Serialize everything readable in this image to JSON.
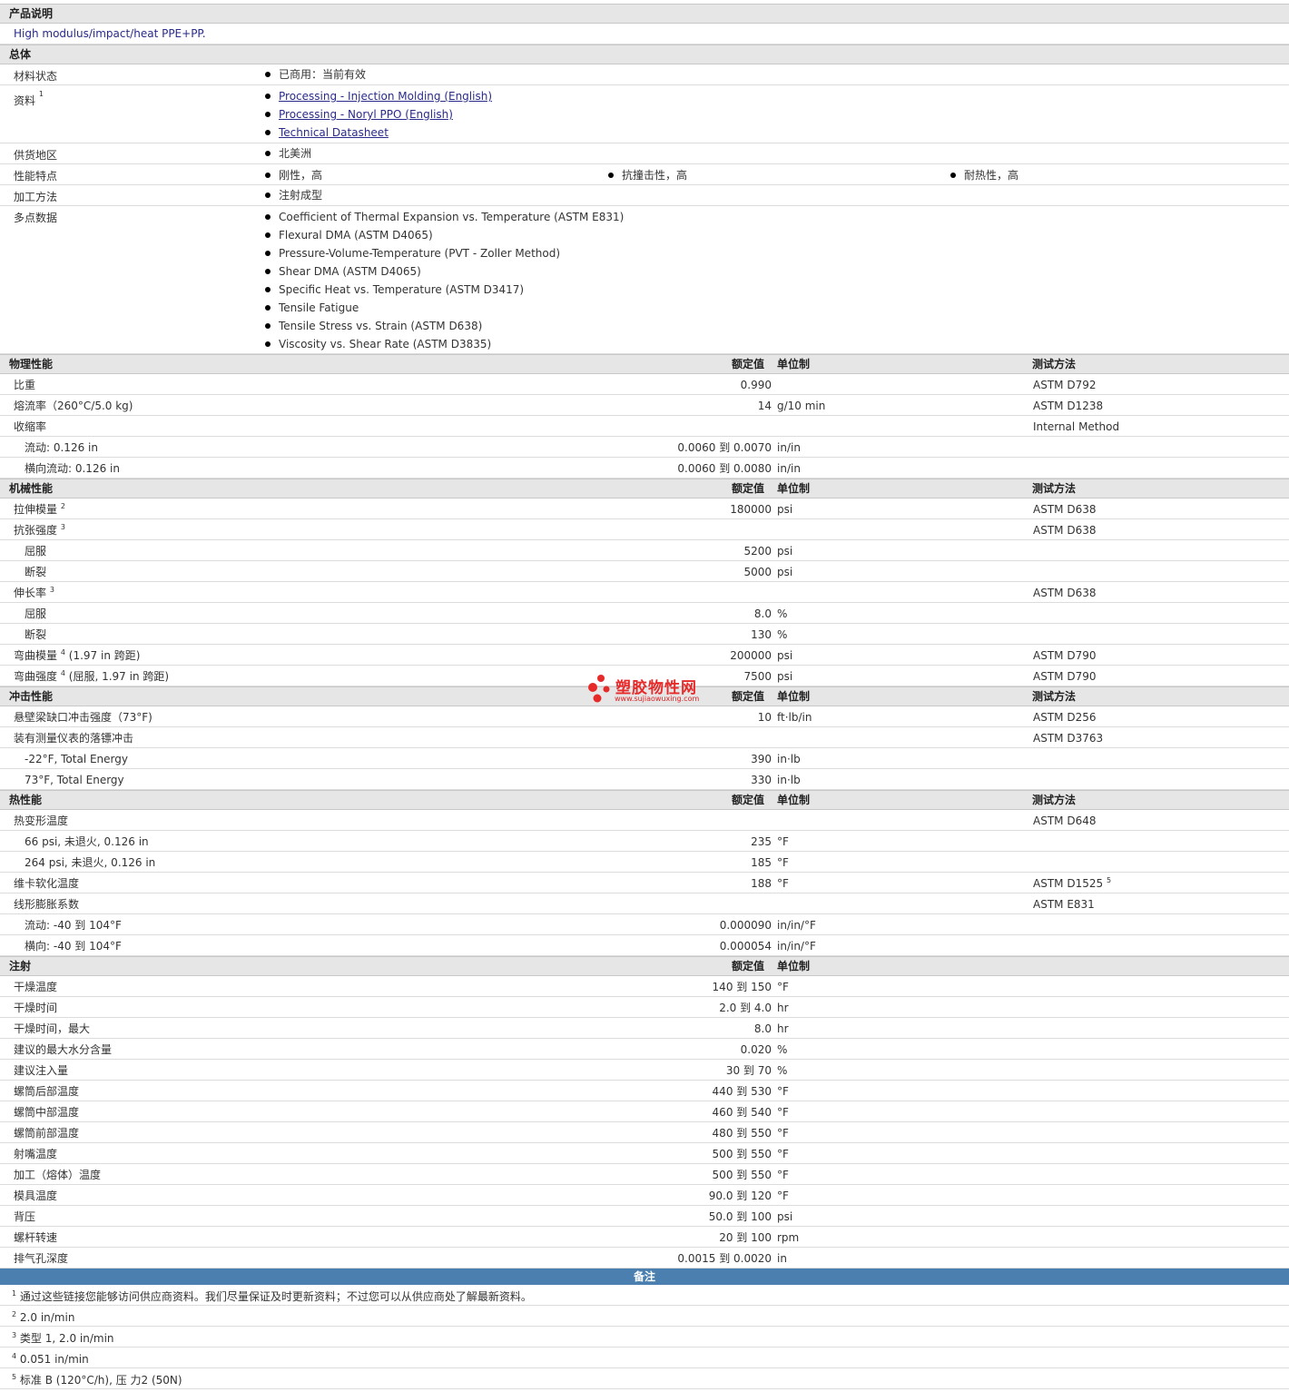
{
  "description": {
    "heading": "产品说明",
    "text": "High modulus/impact/heat PPE+PP."
  },
  "general": {
    "heading": "总体",
    "material_status": {
      "label": "材料状态",
      "value": "已商用：当前有效"
    },
    "documents": {
      "label": "资料",
      "sup": "1",
      "links": [
        "Processing - Injection Molding (English)",
        "Processing - Noryl PPO (English)",
        "Technical Datasheet"
      ]
    },
    "region": {
      "label": "供货地区",
      "value": "北美洲"
    },
    "features": {
      "label": "性能特点",
      "values": [
        "刚性，高",
        "抗撞击性，高",
        "耐热性，高"
      ]
    },
    "processing": {
      "label": "加工方法",
      "value": "注射成型"
    },
    "multipoint": {
      "label": "多点数据",
      "values": [
        "Coefficient of Thermal Expansion vs. Temperature (ASTM E831)",
        "Flexural DMA (ASTM D4065)",
        "Pressure-Volume-Temperature (PVT - Zoller Method)",
        "Shear DMA (ASTM D4065)",
        "Specific Heat vs. Temperature (ASTM D3417)",
        "Tensile Fatigue",
        "Tensile Stress vs. Strain (ASTM D638)",
        "Viscosity vs. Shear Rate (ASTM D3835)"
      ]
    }
  },
  "col_headers": {
    "value": "额定值",
    "unit": "单位制",
    "test": "测试方法"
  },
  "sections": [
    {
      "title": "物理性能",
      "show_test": true,
      "rows": [
        {
          "label": "比重",
          "value": "0.990",
          "unit": "",
          "test": "ASTM D792"
        },
        {
          "label": "熔流率（260°C/5.0 kg)",
          "value": "14",
          "unit": "g/10 min",
          "test": "ASTM D1238"
        },
        {
          "label": "收缩率",
          "value": "",
          "unit": "",
          "test": "Internal Method"
        },
        {
          "label": "流动: 0.126 in",
          "sub": true,
          "value": "0.0060 到  0.0070",
          "unit": "in/in",
          "test": ""
        },
        {
          "label": "横向流动: 0.126 in",
          "sub": true,
          "value": "0.0060 到  0.0080",
          "unit": "in/in",
          "test": ""
        }
      ]
    },
    {
      "title": "机械性能",
      "show_test": true,
      "rows": [
        {
          "label": "拉伸模量",
          "sup": "2",
          "value": "180000",
          "unit": "psi",
          "test": "ASTM D638"
        },
        {
          "label": "抗张强度",
          "sup": "3",
          "value": "",
          "unit": "",
          "test": "ASTM D638"
        },
        {
          "label": "屈服",
          "sub": true,
          "value": "5200",
          "unit": "psi",
          "test": ""
        },
        {
          "label": "断裂",
          "sub": true,
          "value": "5000",
          "unit": "psi",
          "test": ""
        },
        {
          "label": "伸长率",
          "sup": "3",
          "value": "",
          "unit": "",
          "test": "ASTM D638"
        },
        {
          "label": "屈服",
          "sub": true,
          "value": "8.0",
          "unit": "%",
          "test": ""
        },
        {
          "label": "断裂",
          "sub": true,
          "value": "130",
          "unit": "%",
          "test": ""
        },
        {
          "label": "弯曲模量",
          "sup": "4",
          "suffix": "(1.97 in 跨距)",
          "value": "200000",
          "unit": "psi",
          "test": "ASTM D790"
        },
        {
          "label": "弯曲强度",
          "sup": "4",
          "suffix": "(屈服, 1.97 in 跨距)",
          "value": "7500",
          "unit": "psi",
          "test": "ASTM D790"
        }
      ]
    },
    {
      "title": "冲击性能",
      "show_test": true,
      "rows": [
        {
          "label": "悬壁梁缺口冲击强度（73°F)",
          "value": "10",
          "unit": "ft·lb/in",
          "test": "ASTM D256"
        },
        {
          "label": "装有测量仪表的落镖冲击",
          "value": "",
          "unit": "",
          "test": "ASTM D3763"
        },
        {
          "label": "-22°F, Total Energy",
          "sub": true,
          "value": "390",
          "unit": "in·lb",
          "test": ""
        },
        {
          "label": "73°F, Total Energy",
          "sub": true,
          "value": "330",
          "unit": "in·lb",
          "test": ""
        }
      ]
    },
    {
      "title": "热性能",
      "show_test": true,
      "rows": [
        {
          "label": "热变形温度",
          "value": "",
          "unit": "",
          "test": "ASTM D648"
        },
        {
          "label": "66 psi, 未退火, 0.126 in",
          "sub": true,
          "value": "235",
          "unit": "°F",
          "test": ""
        },
        {
          "label": "264 psi, 未退火, 0.126 in",
          "sub": true,
          "value": "185",
          "unit": "°F",
          "test": ""
        },
        {
          "label": "维卡软化温度",
          "value": "188",
          "unit": "°F",
          "test": "ASTM D1525",
          "test_sup": "5"
        },
        {
          "label": "线形膨胀系数",
          "value": "",
          "unit": "",
          "test": "ASTM E831"
        },
        {
          "label": "流动: -40 到  104°F",
          "sub": true,
          "value": "0.000090",
          "unit": "in/in/°F",
          "test": ""
        },
        {
          "label": "横向: -40 到  104°F",
          "sub": true,
          "value": "0.000054",
          "unit": "in/in/°F",
          "test": ""
        }
      ]
    },
    {
      "title": "注射",
      "show_test": false,
      "rows": [
        {
          "label": "干燥温度",
          "value": "140 到  150",
          "unit": "°F",
          "test": ""
        },
        {
          "label": "干燥时间",
          "value": "2.0 到  4.0",
          "unit": "hr",
          "test": ""
        },
        {
          "label": "干燥时间，最大",
          "value": "8.0",
          "unit": "hr",
          "test": ""
        },
        {
          "label": "建议的最大水分含量",
          "value": "0.020",
          "unit": "%",
          "test": ""
        },
        {
          "label": "建议注入量",
          "value": "30 到  70",
          "unit": "%",
          "test": ""
        },
        {
          "label": "螺筒后部温度",
          "value": "440 到  530",
          "unit": "°F",
          "test": ""
        },
        {
          "label": "螺筒中部温度",
          "value": "460 到  540",
          "unit": "°F",
          "test": ""
        },
        {
          "label": "螺筒前部温度",
          "value": "480 到  550",
          "unit": "°F",
          "test": ""
        },
        {
          "label": "射嘴温度",
          "value": "500 到  550",
          "unit": "°F",
          "test": ""
        },
        {
          "label": "加工（熔体）温度",
          "value": "500 到  550",
          "unit": "°F",
          "test": ""
        },
        {
          "label": "模具温度",
          "value": "90.0 到  120",
          "unit": "°F",
          "test": ""
        },
        {
          "label": "背压",
          "value": "50.0 到  100",
          "unit": "psi",
          "test": ""
        },
        {
          "label": "螺杆转速",
          "value": "20 到  100",
          "unit": "rpm",
          "test": ""
        },
        {
          "label": "排气孔深度",
          "value": "0.0015 到  0.0020",
          "unit": "in",
          "test": ""
        }
      ]
    }
  ],
  "notes": {
    "heading": "备注",
    "items": [
      {
        "num": "1",
        "text": "通过这些链接您能够访问供应商资料。我们尽量保证及时更新资料；不过您可以从供应商处了解最新资料。"
      },
      {
        "num": "2",
        "text": "2.0 in/min"
      },
      {
        "num": "3",
        "text": "类型  1, 2.0 in/min"
      },
      {
        "num": "4",
        "text": "0.051 in/min"
      },
      {
        "num": "5",
        "text": "标准  B (120°C/h), 压  力2 (50N)"
      }
    ]
  },
  "watermark": {
    "name": "塑胶物性网",
    "url": "www.sujiaowuxing.com"
  }
}
